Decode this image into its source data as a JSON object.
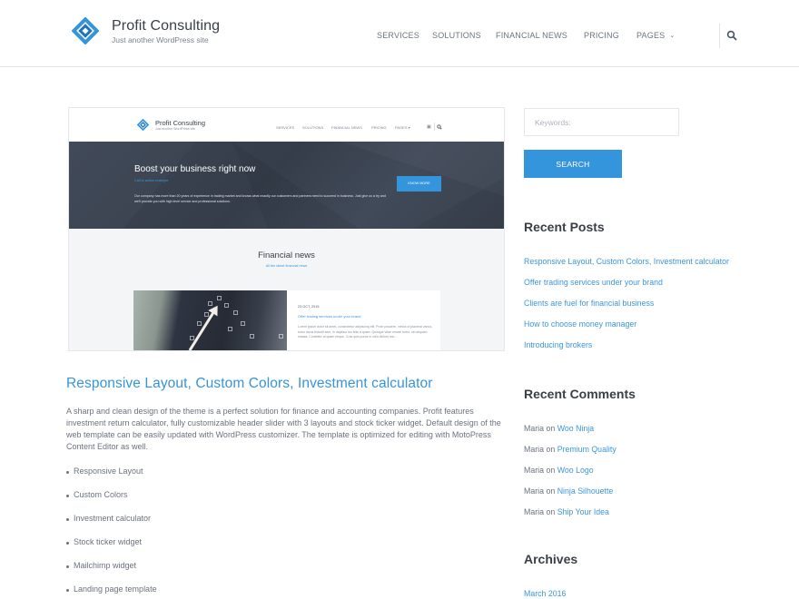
{
  "header": {
    "site_title": "Profit Consulting",
    "site_description": "Just another WordPress site",
    "logo_icon": "diamond-link-logo-icon",
    "nav": [
      {
        "label": "SERVICES"
      },
      {
        "label": "SOLUTIONS"
      },
      {
        "label": "FINANCIAL NEWS"
      },
      {
        "label": "PRICING"
      },
      {
        "label": "PAGES",
        "has_dropdown": true
      }
    ],
    "search_icon": "search-icon"
  },
  "featured_image": {
    "mock_header": {
      "site_title": "Profit Consulting",
      "site_description": "Just another WordPress site",
      "nav": [
        "SERVICES",
        "SOLUTIONS",
        "FINANCIAL NEWS",
        "PRICING",
        "PAGES ▾"
      ],
      "cart_icon": "cart-icon",
      "search_icon": "search-icon"
    },
    "hero": {
      "title": "Boost your business right now",
      "subtitle": "Call to action example",
      "text": "Our company has more than 20 years of experience in trading market and knows what exactly our customers and partners need to succeed in business. Just give us a try and we'll provide you with high level service and professional solutions.",
      "button_label": "KNOW MORE"
    },
    "news": {
      "title": "Financial news",
      "subtitle": "All the latest financial news",
      "card": {
        "date": "23 OCT, 2015",
        "link": "Offer trading services under your brand",
        "text": "Lorem ipsum dolor sit amet, consectetur adipiscing elit. Proin posuere, metus ut placerat varius, tortor lacus blandit sem, in dapibus leo felis a quam. Quisque vitae ornare tortor, vel aliquam massa. Curabitur at quam neque. Cras quis purus in odio dictum ma..."
      }
    }
  },
  "post": {
    "title": "Responsive Layout, Custom Colors, Investment calculator",
    "excerpt": "A sharp and clean design of the theme is a perfect solution for finance and accounting companies. Profit features investment return calculator, fully customizable header slider with 3 layouts and stock ticker widget. Default design of the web template can be easily updated with WordPress customizer. The template is optimized for editing with MotoPress Content Editor as well.",
    "features": [
      "Responsive Layout",
      "Custom Colors",
      "Investment calculator",
      "Stock ticker widget",
      "Mailchimp widget",
      "Landing page template"
    ]
  },
  "sidebar": {
    "search": {
      "placeholder": "Keywords:",
      "value": "",
      "button_label": "SEARCH"
    },
    "recent_posts": {
      "title": "Recent Posts",
      "items": [
        "Responsive Layout, Custom Colors, Investment calculator",
        "Offer trading services under your brand",
        "Clients are fuel for financial business",
        "How to choose money manager",
        "Introducing brokers"
      ]
    },
    "recent_comments": {
      "title": "Recent Comments",
      "items": [
        {
          "author": "Maria",
          "on": "on",
          "post": "Woo Ninja"
        },
        {
          "author": "Maria",
          "on": "on",
          "post": "Premium Quality"
        },
        {
          "author": "Maria",
          "on": "on",
          "post": "Woo Logo"
        },
        {
          "author": "Maria",
          "on": "on",
          "post": "Ninja Silhouette"
        },
        {
          "author": "Maria",
          "on": "on",
          "post": "Ship Your Idea"
        }
      ]
    },
    "archives": {
      "title": "Archives",
      "items": [
        "March 2016"
      ]
    }
  },
  "colors": {
    "accent": "#3595dc",
    "heading": "#3a3f47",
    "body_text": "#6b7280",
    "hero_bg": "#3a4250"
  }
}
